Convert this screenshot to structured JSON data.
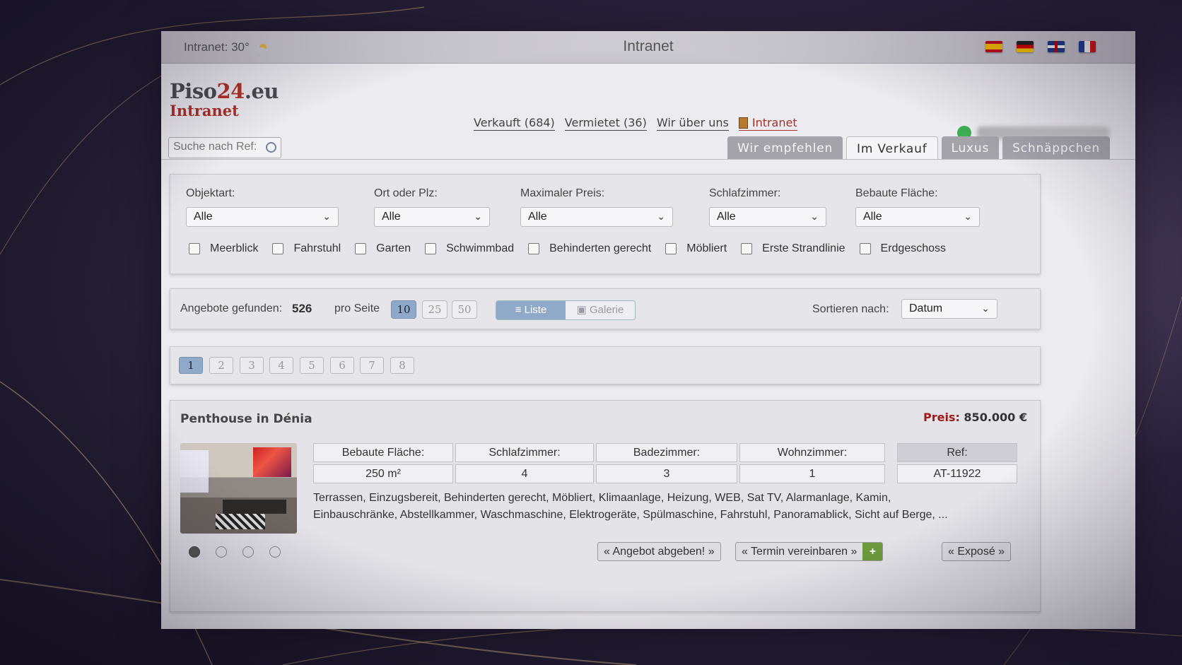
{
  "titlebar": {
    "weather": "Intranet: 30°",
    "title": "Intranet",
    "flags": [
      "es",
      "de",
      "gb",
      "fr"
    ]
  },
  "logo": {
    "brand_a": "Piso",
    "brand_num": "24",
    "brand_b": ".eu",
    "subtitle": "Intranet"
  },
  "nav": {
    "items": [
      "Verkauft (684)",
      "Vermietet (36)",
      "Wir über uns",
      "Intranet"
    ]
  },
  "search": {
    "placeholder": "Suche nach Ref:"
  },
  "tabs": [
    "Wir empfehlen",
    "Im Verkauf",
    "Luxus",
    "Schnäppchen"
  ],
  "active_tab": "Im Verkauf",
  "filters": {
    "selects": [
      {
        "label": "Objektart:",
        "value": "Alle"
      },
      {
        "label": "Ort oder Plz:",
        "value": "Alle"
      },
      {
        "label": "Maximaler Preis:",
        "value": "Alle"
      },
      {
        "label": "Schlafzimmer:",
        "value": "Alle"
      },
      {
        "label": "Bebaute Fläche:",
        "value": "Alle"
      }
    ],
    "checkboxes": [
      "Meerblick",
      "Fahrstuhl",
      "Garten",
      "Schwimmbad",
      "Behinderten gerecht",
      "Möbliert",
      "Erste Strandlinie",
      "Erdgeschoss"
    ]
  },
  "results": {
    "found_label": "Angebote gefunden:",
    "count": "526",
    "per_page_label": "pro Seite",
    "per_page": [
      "10",
      "25",
      "50"
    ],
    "view_list": "Liste",
    "view_gallery": "Galerie",
    "sort_label": "Sortieren nach:",
    "sort_value": "Datum"
  },
  "pager": [
    "1",
    "2",
    "3",
    "4",
    "5",
    "6",
    "7",
    "8"
  ],
  "listing": {
    "title": "Penthouse in Dénia",
    "price_label": "Preis:",
    "price_value": "850.000 €",
    "specs": [
      {
        "h": "Bebaute Fläche:",
        "v": "250 m²"
      },
      {
        "h": "Schlafzimmer:",
        "v": "4"
      },
      {
        "h": "Badezimmer:",
        "v": "3"
      },
      {
        "h": "Wohnzimmer:",
        "v": "1"
      }
    ],
    "ref": {
      "h": "Ref:",
      "v": "AT-11922"
    },
    "desc_line1": "Terrassen, Einzugsbereit, Behinderten gerecht, Möbliert, Klimaanlage, Heizung, WEB, Sat TV, Alarmanlage, Kamin,",
    "desc_line2": "Einbauschränke, Abstellkammer, Waschmaschine, Elektrogeräte, Spülmaschine, Fahrstuhl, Panoramablick, Sicht auf Berge, ...",
    "btn_offer": "« Angebot abgeben! »",
    "btn_appointment": "« Termin vereinbaren »",
    "btn_plus": "+",
    "btn_expose": "« Exposé »"
  },
  "colors": {
    "accent": "#8faac8",
    "brand_red": "#a8302a",
    "whatsapp": "#3cae53"
  }
}
